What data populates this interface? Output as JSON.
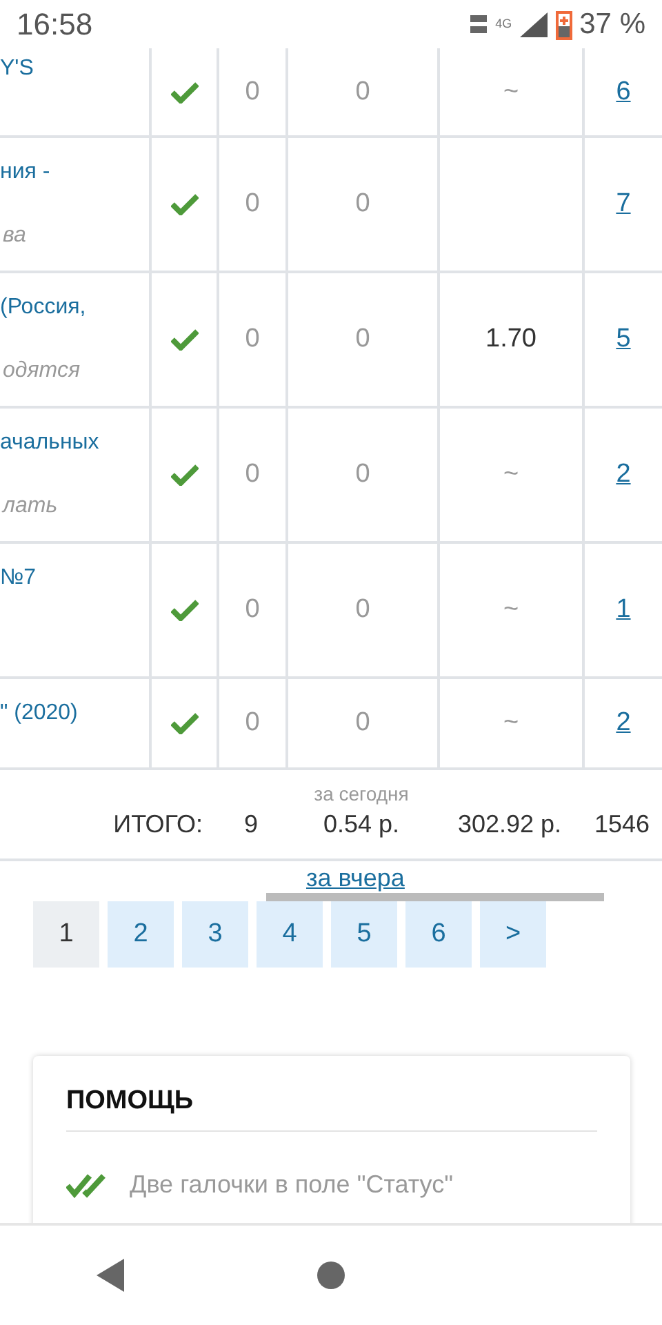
{
  "status_bar": {
    "time": "16:58",
    "network": "4G",
    "battery": "37 %"
  },
  "table": {
    "rows": [
      {
        "title": "Y'S",
        "subtitle": "",
        "checked": true,
        "col_3": "0",
        "col_4": "0",
        "col_5": "~",
        "link": "6"
      },
      {
        "title": "ния -",
        "subtitle": "ва",
        "checked": true,
        "col_3": "0",
        "col_4": "0",
        "col_5": "",
        "link": "7"
      },
      {
        "title": "(Россия,",
        "subtitle": "одятся",
        "checked": true,
        "col_3": "0",
        "col_4": "0",
        "col_5": "1.70",
        "link": "5"
      },
      {
        "title": "ачальных",
        "subtitle": "лать",
        "checked": true,
        "col_3": "0",
        "col_4": "0",
        "col_5": "~",
        "link": "2"
      },
      {
        "title": "№7",
        "subtitle": "",
        "checked": true,
        "col_3": "0",
        "col_4": "0",
        "col_5": "~",
        "link": "1"
      },
      {
        "title": "\" (2020)",
        "subtitle": "",
        "checked": true,
        "col_3": "0",
        "col_4": "0",
        "col_5": "~",
        "link": "2"
      }
    ],
    "totals": {
      "label": "ИТОГО:",
      "count": "9",
      "today_caption": "за сегодня",
      "today": "0.54 р.",
      "sum": "302.92 р.",
      "views": "1546"
    },
    "yesterday_link": "за вчера"
  },
  "pagination": [
    {
      "label": "1",
      "selected": true
    },
    {
      "label": "2",
      "selected": false
    },
    {
      "label": "3",
      "selected": false
    },
    {
      "label": "4",
      "selected": false
    },
    {
      "label": "5",
      "selected": false
    },
    {
      "label": "6",
      "selected": false
    },
    {
      "label": ">",
      "selected": false
    }
  ],
  "help": {
    "title": "ПОМОЩЬ",
    "items": [
      {
        "text": "Две галочки в поле \"Статус\""
      }
    ]
  }
}
